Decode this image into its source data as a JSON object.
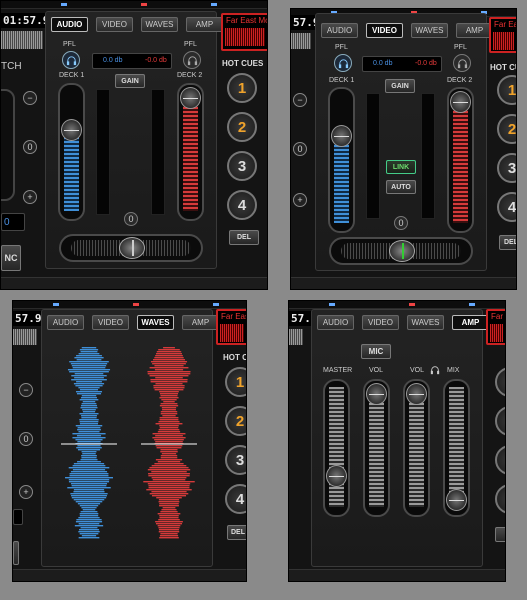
{
  "tabs": [
    "AUDIO",
    "VIDEO",
    "WAVES",
    "AMP"
  ],
  "time": "01:57.9",
  "time_short": "57.9",
  "track_title": "Far East Movement",
  "track_short": "Far East",
  "deck_1": "DECK 1",
  "deck_2": "DECK 2",
  "pfl": "PFL",
  "db_left": "0.0 db",
  "db_right": "-0.0 db",
  "gain": "GAIN",
  "link": "LINK",
  "auto": "AUTO",
  "zero": "0",
  "hot_cues_label": "HOT CUES",
  "hot_cues": [
    "1",
    "2",
    "3",
    "4"
  ],
  "del": "DEL",
  "sync_short": "NC",
  "pitch_short": "TCH",
  "amp": {
    "mic": "MIC",
    "master": "MASTER",
    "vol_1": "VOL",
    "vol_2": "VOL",
    "mix": "MIX"
  },
  "colors": {
    "deck1": "#3f8fd8",
    "deck2": "#d53a3a",
    "hotcue_set": "#f0a32b",
    "link": "#6ddc6d"
  }
}
